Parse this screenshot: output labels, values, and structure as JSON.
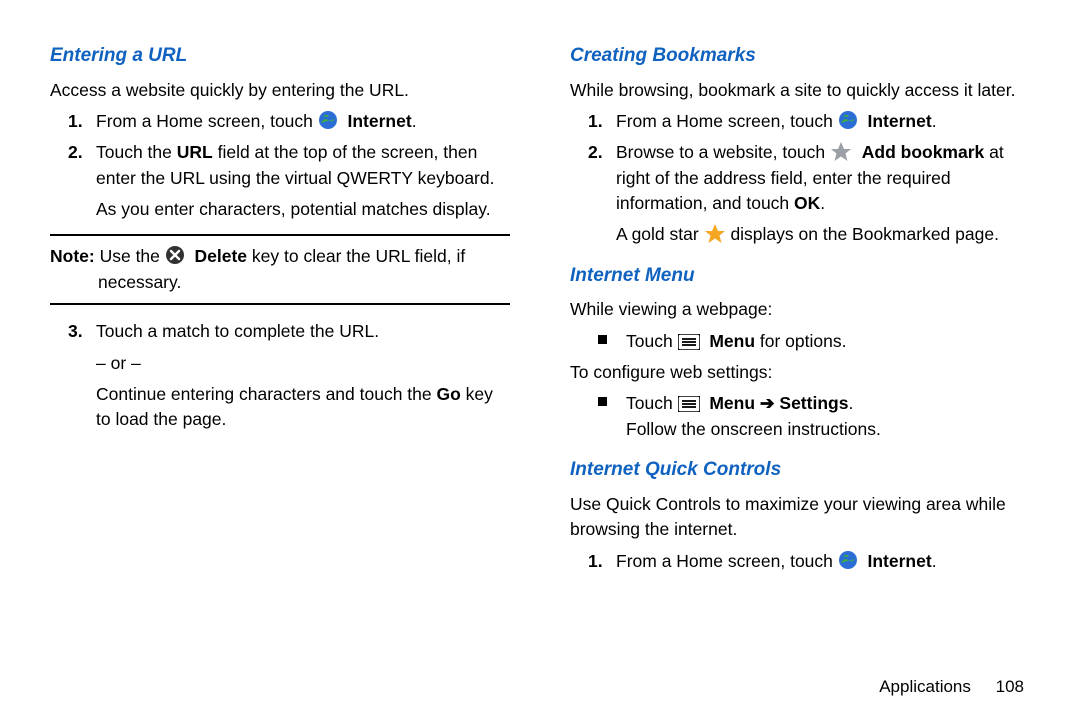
{
  "left": {
    "h1": "Entering a URL",
    "intro": "Access a website quickly by entering the URL.",
    "step1_a": "From a Home screen, touch ",
    "step1_b": "Internet",
    "step1_c": ".",
    "step2_a": "Touch the ",
    "step2_b": "URL",
    "step2_c": " field at the top of the screen, then enter the URL using the virtual QWERTY keyboard.",
    "step2_d": "As you enter characters, potential matches display.",
    "note_label": "Note:",
    "note_a": " Use the ",
    "note_b": "Delete",
    "note_c": " key to clear the URL field, if necessary.",
    "step3_a": "Touch a match to complete the URL.",
    "step3_or": "– or –",
    "step3_b_a": "Continue entering characters and touch the ",
    "step3_b_b": "Go",
    "step3_b_c": " key to load the page."
  },
  "right": {
    "h1": "Creating Bookmarks",
    "intro": "While browsing, bookmark a site to quickly access it later.",
    "step1_a": "From a Home screen, touch ",
    "step1_b": "Internet",
    "step1_c": ".",
    "step2_a": "Browse to a website, touch ",
    "step2_b": "Add bookmark",
    "step2_c": " at right of the address field, enter the required information, and touch ",
    "step2_d": "OK",
    "step2_e": ".",
    "step2_f": "A gold star ",
    "step2_g": " displays on the Bookmarked page.",
    "h2": "Internet Menu",
    "im_intro": "While viewing a webpage:",
    "im_b1_a": "Touch ",
    "im_b1_b": "Menu",
    "im_b1_c": " for options.",
    "im_conf": "To configure web settings:",
    "im_b2_a": "Touch ",
    "im_b2_b": "Menu",
    "im_b2_arrow": " ➔ ",
    "im_b2_c": "Settings",
    "im_b2_d": ".",
    "im_b2_e": "Follow the onscreen instructions.",
    "h3": "Internet Quick Controls",
    "qc_intro": "Use Quick Controls to maximize your viewing area while browsing the internet.",
    "qc1_a": "From a Home screen, touch ",
    "qc1_b": "Internet",
    "qc1_c": "."
  },
  "footer": {
    "section": "Applications",
    "page": "108"
  },
  "nums": {
    "n1": "1.",
    "n2": "2.",
    "n3": "3."
  }
}
